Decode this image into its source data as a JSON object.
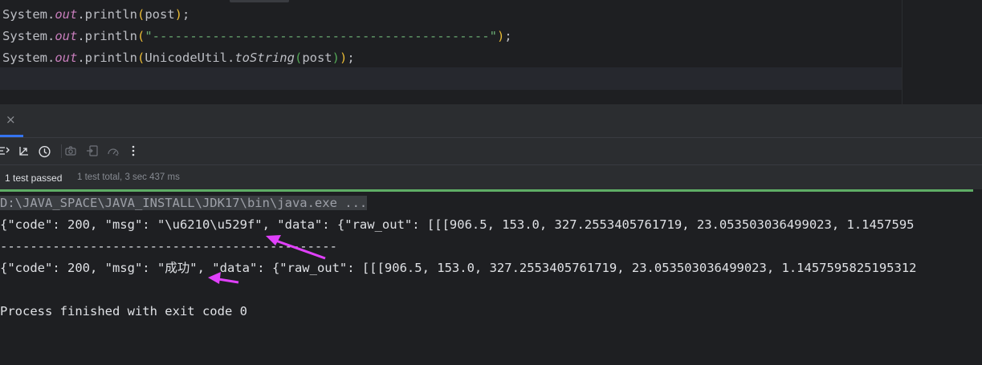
{
  "editor": {
    "line1": {
      "prefix": "System.",
      "field": "out",
      "call": ".println",
      "open": "(",
      "arg": "post",
      "close": ")",
      "end": ";"
    },
    "line2": {
      "prefix": "System.",
      "field": "out",
      "call": ".println",
      "open": "(",
      "str": "\"---------------------------------------------\"",
      "close": ")",
      "end": ";"
    },
    "line3": {
      "prefix": "System.",
      "field": "out",
      "call": ".println",
      "open": "(",
      "cls": "UnicodeUtil.",
      "method": "toString",
      "iopen": "(",
      "arg": "post",
      "iclose": ")",
      "close": ")",
      "end": ";"
    }
  },
  "run_panel": {
    "close_glyph": "×",
    "toolbar_icons": [
      "sort-tests-icon",
      "collapse-icon",
      "history-icon",
      "camera-icon",
      "import-icon",
      "speed-icon",
      "more-icon"
    ],
    "status": {
      "passed": "1 test passed",
      "detail": "1 test total, 3 sec 437 ms"
    },
    "console": {
      "cmd": "D:\\JAVA_SPACE\\JAVA_INSTALL\\JDK17\\bin\\java.exe ...",
      "line1": "{\"code\": 200, \"msg\": \"\\u6210\\u529f\", \"data\": {\"raw_out\": [[[906.5, 153.0, 327.2553405761719, 23.053503036499023, 1.1457595",
      "separator": "---------------------------------------------",
      "line2": "{\"code\": 200, \"msg\": \"成功\", \"data\": {\"raw_out\": [[[906.5, 153.0, 327.2553405761719, 23.053503036499023, 1.1457595825195312",
      "exit": "Process finished with exit code 0"
    }
  },
  "colors": {
    "accent_blue": "#3574f0",
    "pass_green": "#5fad65",
    "annotation_magenta": "#e040fb"
  }
}
